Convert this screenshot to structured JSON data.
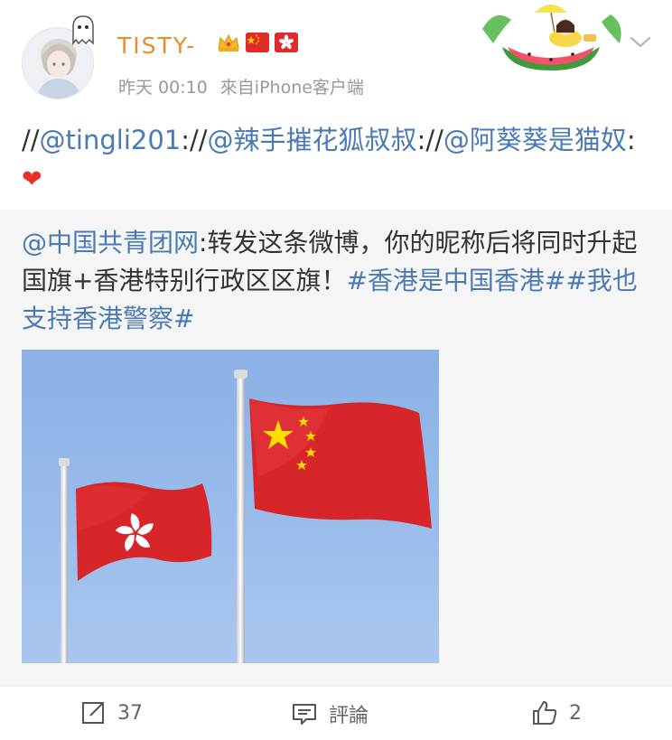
{
  "header": {
    "username": "TISTY-",
    "time": "昨天 00:10",
    "source": "來自iPhone客户端"
  },
  "icons": {
    "avatar": "user-avatar",
    "ghost": "ghost-icon",
    "crown": "crown-badge-icon",
    "cn_flag": "china-flag-icon",
    "hk_flag": "hong-kong-flag-icon",
    "decor": "watermelon-float-decoration",
    "chevron": "chevron-down-icon"
  },
  "repost": {
    "p1": "//",
    "m1": "@tingli201",
    "p2": "://",
    "m2": "@辣手摧花狐叔叔",
    "p3": "://",
    "m3": "@阿葵葵是猫奴",
    "p4": ":",
    "heart": "❤"
  },
  "quoted": {
    "mention": "@中国共青团网",
    "body": ":转发这条微博，你的昵称后将同时升起国旗+香港特别行政区区旗！",
    "tag1": "#香港是中国香港#",
    "tag2": "#我也支持香港警察#"
  },
  "actions": {
    "repost_count": "37",
    "comment_label": "評論",
    "like_count": "2"
  },
  "colors": {
    "username": "#ef8b2b",
    "link": "#4a7ab6",
    "flag_red": "#e12a2a",
    "sky": "#8fb3ea"
  }
}
